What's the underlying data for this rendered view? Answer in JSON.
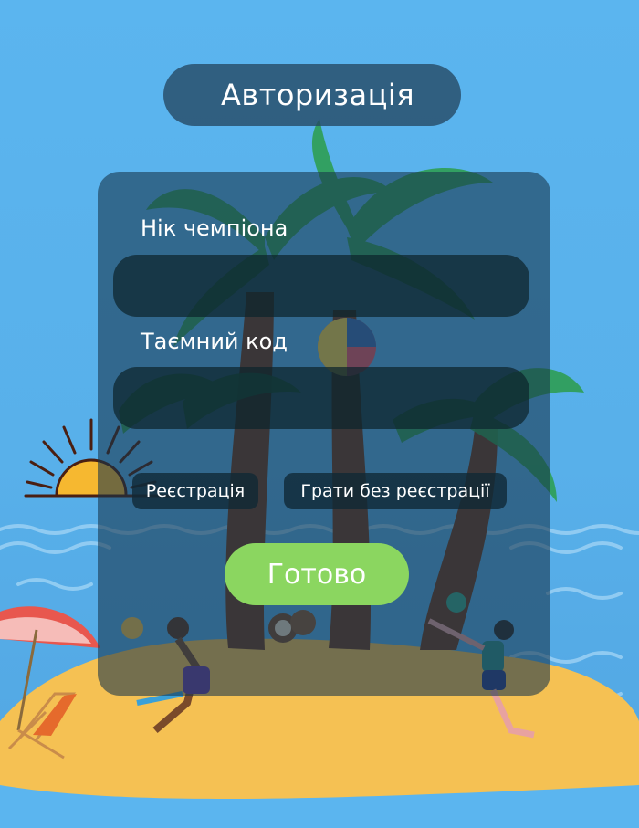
{
  "header": {
    "title": "Авторизація"
  },
  "form": {
    "nickname_label": "Нік чемпіона",
    "nickname_value": "",
    "password_label": "Таємний код",
    "password_value": ""
  },
  "links": {
    "register": "Реєстрація",
    "play_without_registration": "Грати без реєстрації"
  },
  "actions": {
    "submit": "Готово"
  },
  "colors": {
    "sky": "#5bb5ef",
    "sand": "#f5c153",
    "submit": "#8bd660",
    "panel": "#17344a"
  }
}
